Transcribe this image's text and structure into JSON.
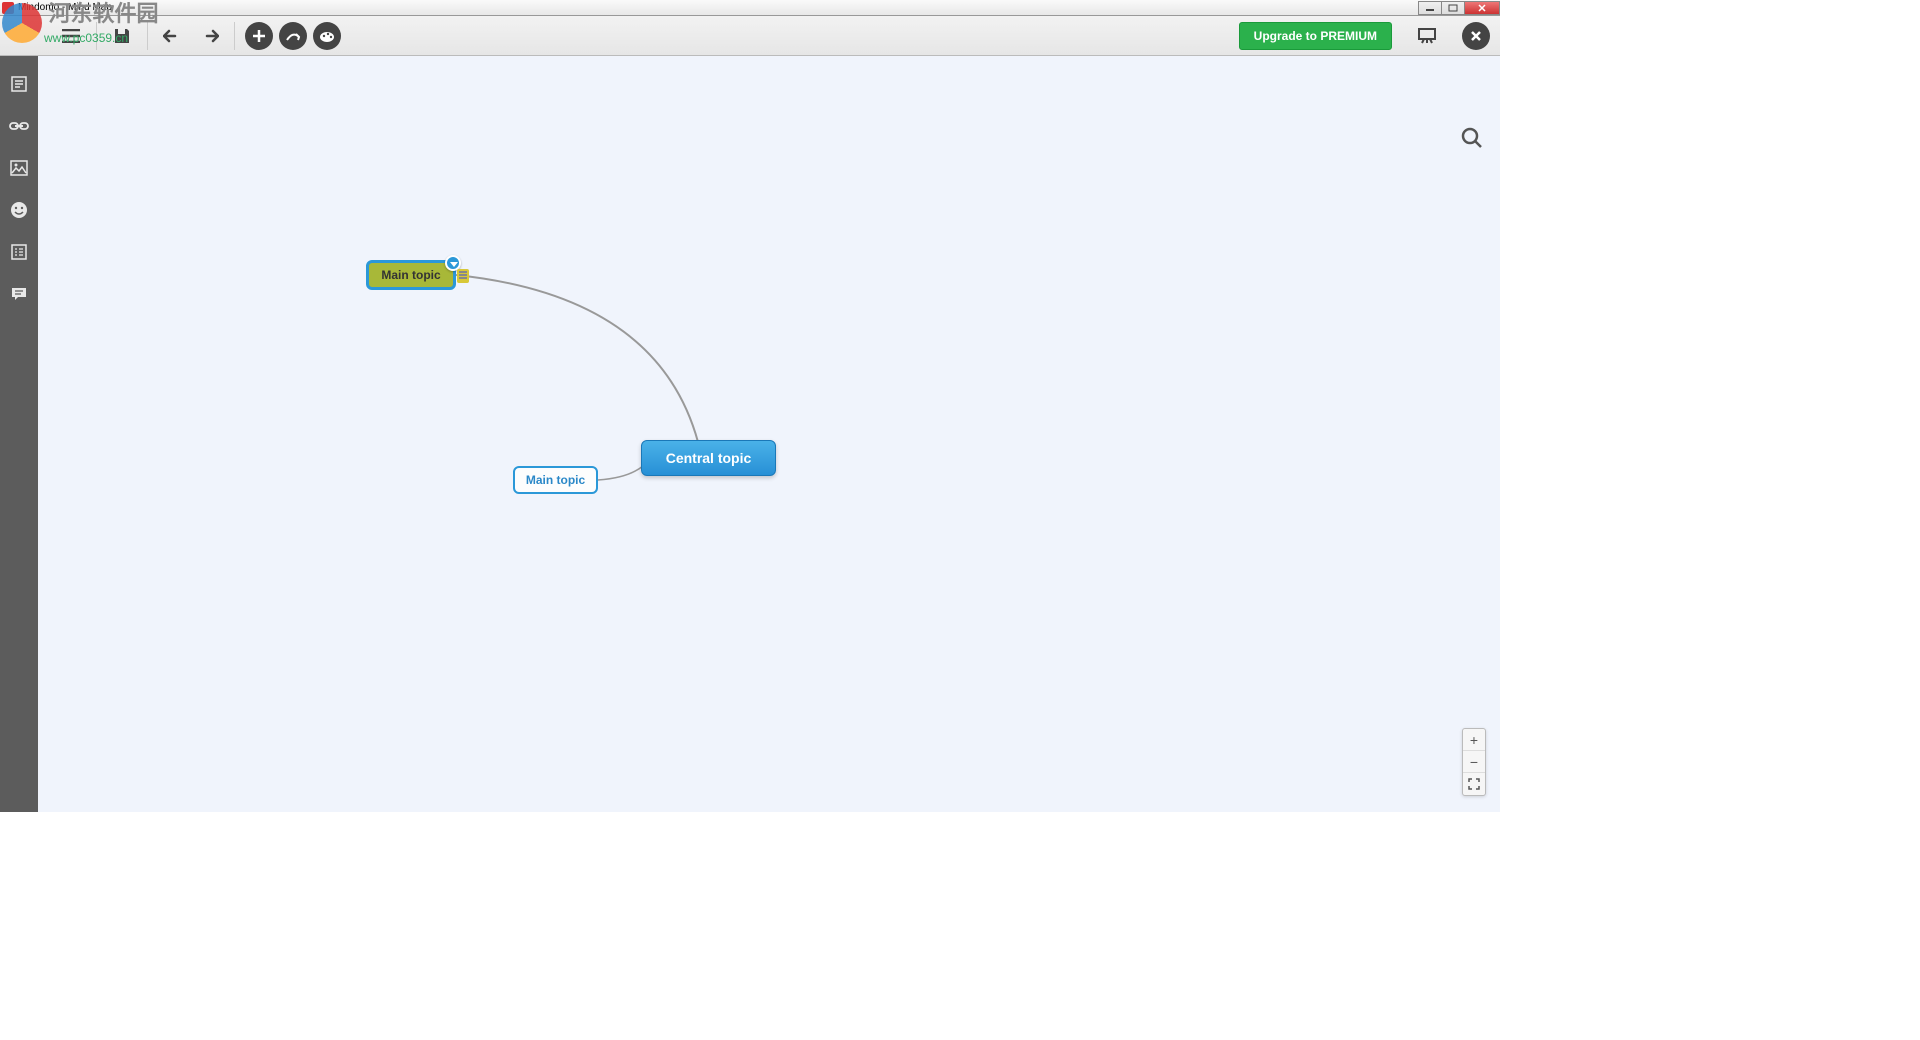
{
  "window": {
    "title": "Mindomo - Mind Map"
  },
  "watermark": {
    "text": "河东软件园",
    "url": "www.pc0359.cn"
  },
  "toolbar": {
    "upgrade_label": "Upgrade to PREMIUM"
  },
  "nodes": {
    "central": "Central topic",
    "main1": "Main topic",
    "main2": "Main topic"
  },
  "icons": {
    "menu": "menu",
    "save": "save",
    "undo": "undo",
    "redo": "redo",
    "add": "add",
    "relation": "relation",
    "theme": "theme",
    "present": "present",
    "close": "close",
    "notes": "notes",
    "link": "link",
    "image": "image",
    "emoji": "emoji",
    "task": "task",
    "comment": "comment",
    "search": "search",
    "zoom_in": "+",
    "zoom_out": "−",
    "zoom_fit": "⛶"
  }
}
